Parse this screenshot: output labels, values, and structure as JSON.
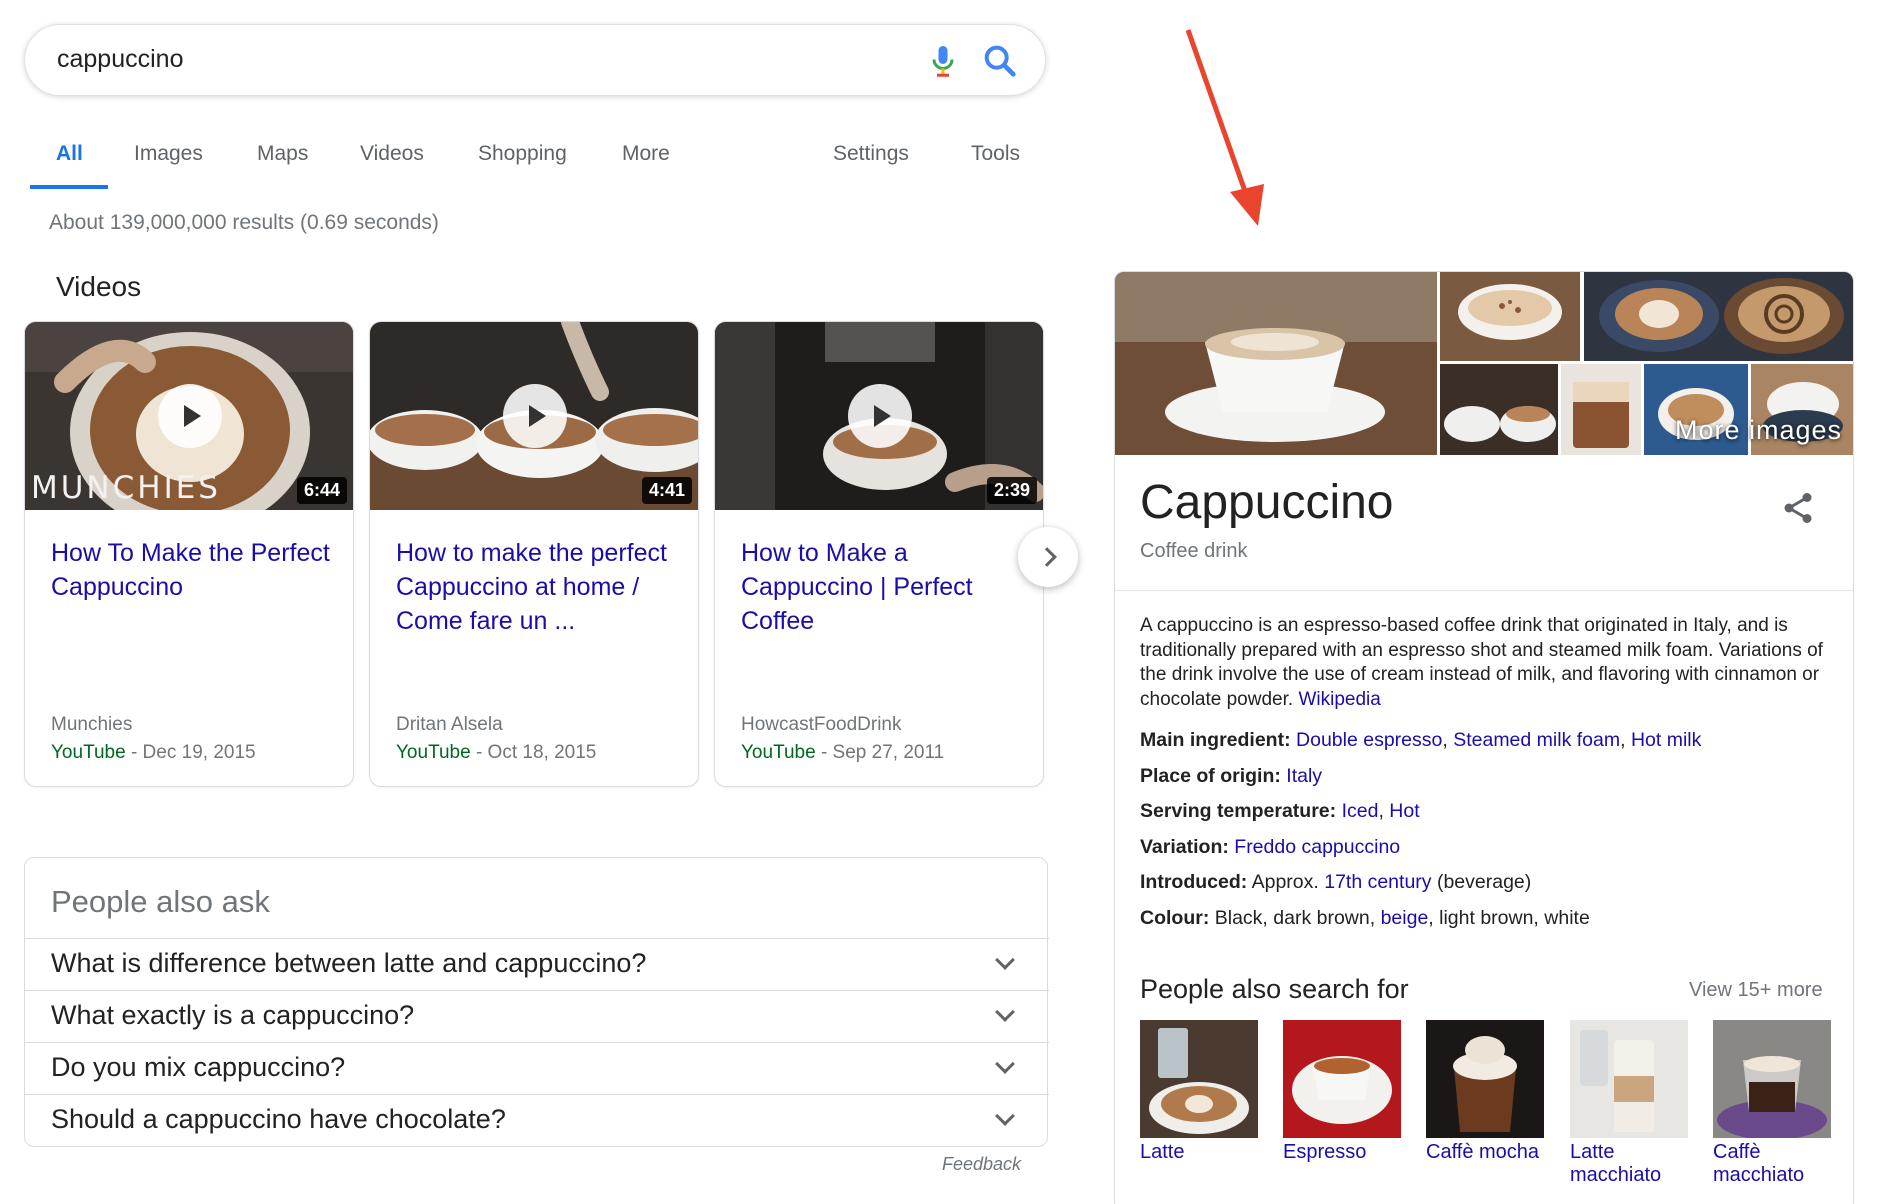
{
  "search": {
    "query": "cappuccino"
  },
  "tabs": [
    "All",
    "Images",
    "Maps",
    "Videos",
    "Shopping",
    "More",
    "Settings",
    "Tools"
  ],
  "result_stats": "About 139,000,000 results (0.69 seconds)",
  "videos": {
    "heading": "Videos",
    "items": [
      {
        "title": "How To Make the Perfect Cappuccino",
        "source": "Munchies",
        "platform": "YouTube",
        "date": " - Dec 19, 2015",
        "duration": "6:44",
        "overlay_text": "MUNCHIES"
      },
      {
        "title": "How to make the perfect Cappuccino at home / Come fare un ...",
        "source": "Dritan Alsela",
        "platform": "YouTube",
        "date": " - Oct 18, 2015",
        "duration": "4:41"
      },
      {
        "title": "How to Make a Cappuccino | Perfect Coffee",
        "source": "HowcastFoodDrink",
        "platform": "YouTube",
        "date": " - Sep 27, 2011",
        "duration": "2:39"
      }
    ]
  },
  "people_also_ask": {
    "title": "People also ask",
    "questions": [
      "What is difference between latte and cappuccino?",
      "What exactly is a cappuccino?",
      "Do you mix cappuccino?",
      "Should a cappuccino have chocolate?"
    ],
    "feedback": "Feedback"
  },
  "knowledge_panel": {
    "more_images": "More images",
    "title": "Cappuccino",
    "subtitle": "Coffee drink",
    "description": "A cappuccino is an espresso-based coffee drink that originated in Italy, and is traditionally prepared with an espresso shot and steamed milk foam. Variations of the drink involve the use of cream instead of milk, and flavoring with cinnamon or chocolate powder.",
    "description_link": "Wikipedia",
    "facts": {
      "main_ingredient": {
        "label": "Main ingredient:",
        "links": [
          "Double espresso",
          "Steamed milk foam",
          "Hot milk"
        ]
      },
      "place_of_origin": {
        "label": "Place of origin:",
        "link": "Italy"
      },
      "serving_temperature": {
        "label": "Serving temperature:",
        "links": [
          "Iced",
          "Hot"
        ]
      },
      "variation": {
        "label": "Variation:",
        "link": "Freddo cappuccino"
      },
      "introduced": {
        "label": "Introduced:",
        "prefix": "Approx.",
        "link": "17th century",
        "suffix": "(beverage)"
      },
      "colour": {
        "label": "Colour:",
        "before": "Black, dark brown,",
        "link": "beige",
        "after": ", light brown, white"
      }
    },
    "people_also_search": {
      "title": "People also search for",
      "view_more": "View 15+ more",
      "items": [
        {
          "label": "Latte"
        },
        {
          "label": "Espresso"
        },
        {
          "label": "Caffè mocha"
        },
        {
          "label": "Latte macchiato"
        },
        {
          "label": "Caffè macchiato"
        }
      ]
    }
  },
  "colors": {
    "link": "#1a0dab",
    "accent": "#1a73e8",
    "url_green": "#006621",
    "arrow": "#e8442e"
  }
}
